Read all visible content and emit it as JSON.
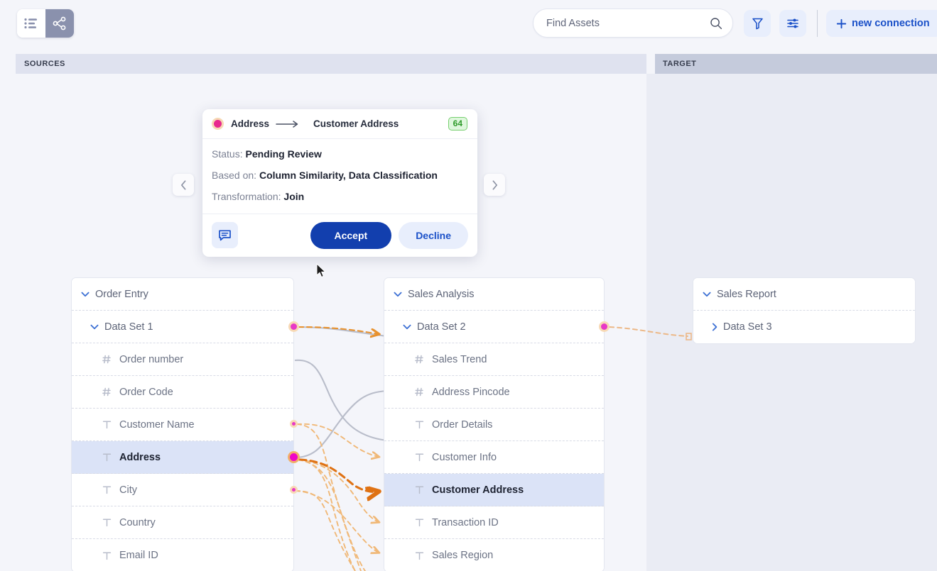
{
  "toolbar": {
    "view_list_icon": "list-view-icon",
    "view_graph_icon": "graph-view-icon",
    "search": {
      "value": "",
      "placeholder": "Find Assets",
      "icon": "search-icon"
    },
    "filter_icon": "filter-icon",
    "settings_icon": "sliders-icon",
    "new_connection": {
      "label": "new connection",
      "icon": "plus-icon"
    }
  },
  "bands": {
    "sources": "SOURCES",
    "target": "TARGET"
  },
  "card": {
    "source_field": "Address",
    "target_field": "Customer Address",
    "arrow_icon": "arrow-right-icon",
    "score_badge": "64",
    "rows": [
      {
        "label": "Status:",
        "value": "Pending Review"
      },
      {
        "label": "Based on:",
        "value": "Column Similarity, Data Classification"
      },
      {
        "label": "Transformation:",
        "value": "Join"
      }
    ],
    "chat_icon": "comment-icon",
    "accept_label": "Accept",
    "decline_label": "Decline",
    "prev_icon": "chevron-left-icon",
    "next_icon": "chevron-right-icon"
  },
  "panels": [
    {
      "id": "order-entry",
      "rows": [
        {
          "label": "Order Entry",
          "level": 0,
          "caret": "chevron-down",
          "type": "",
          "selected": false
        },
        {
          "label": "Data Set 1",
          "level": 1,
          "caret": "chevron-down",
          "type": "",
          "selected": false
        },
        {
          "label": "Order number",
          "level": 2,
          "caret": "",
          "type": "#",
          "selected": false
        },
        {
          "label": "Order Code",
          "level": 2,
          "caret": "",
          "type": "#",
          "selected": false
        },
        {
          "label": "Customer Name",
          "level": 2,
          "caret": "",
          "type": "T",
          "selected": false
        },
        {
          "label": "Address",
          "level": 2,
          "caret": "",
          "type": "T",
          "selected": true
        },
        {
          "label": "City",
          "level": 2,
          "caret": "",
          "type": "T",
          "selected": false
        },
        {
          "label": "Country",
          "level": 2,
          "caret": "",
          "type": "T",
          "selected": false
        },
        {
          "label": "Email ID",
          "level": 2,
          "caret": "",
          "type": "T",
          "selected": false
        }
      ]
    },
    {
      "id": "sales-analysis",
      "rows": [
        {
          "label": "Sales Analysis",
          "level": 0,
          "caret": "chevron-down",
          "type": "",
          "selected": false
        },
        {
          "label": "Data Set 2",
          "level": 1,
          "caret": "chevron-down",
          "type": "",
          "selected": false
        },
        {
          "label": "Sales Trend",
          "level": 2,
          "caret": "",
          "type": "#",
          "selected": false
        },
        {
          "label": "Address Pincode",
          "level": 2,
          "caret": "",
          "type": "#",
          "selected": false
        },
        {
          "label": "Order Details",
          "level": 2,
          "caret": "",
          "type": "T",
          "selected": false
        },
        {
          "label": "Customer Info",
          "level": 2,
          "caret": "",
          "type": "T",
          "selected": false
        },
        {
          "label": "Customer Address",
          "level": 2,
          "caret": "",
          "type": "T",
          "selected": true
        },
        {
          "label": "Transaction ID",
          "level": 2,
          "caret": "",
          "type": "T",
          "selected": false
        },
        {
          "label": "Sales Region",
          "level": 2,
          "caret": "",
          "type": "T",
          "selected": false
        }
      ]
    },
    {
      "id": "sales-report",
      "rows": [
        {
          "label": "Sales Report",
          "level": 0,
          "caret": "chevron-down",
          "type": "",
          "selected": false
        },
        {
          "label": "Data Set 3",
          "level": 1,
          "caret": "chevron-right",
          "type": "",
          "selected": false
        }
      ]
    }
  ],
  "colors": {
    "accent_blue": "#1a50c8",
    "accept_blue": "#123fae",
    "magenta_node": "#e838c6",
    "link_orange": "#e8922f",
    "link_orange_strong": "#e06a10",
    "link_grey": "#b6bbc8",
    "badge_green": "#2f9b2a",
    "row_selected": "#dbe3f7"
  }
}
